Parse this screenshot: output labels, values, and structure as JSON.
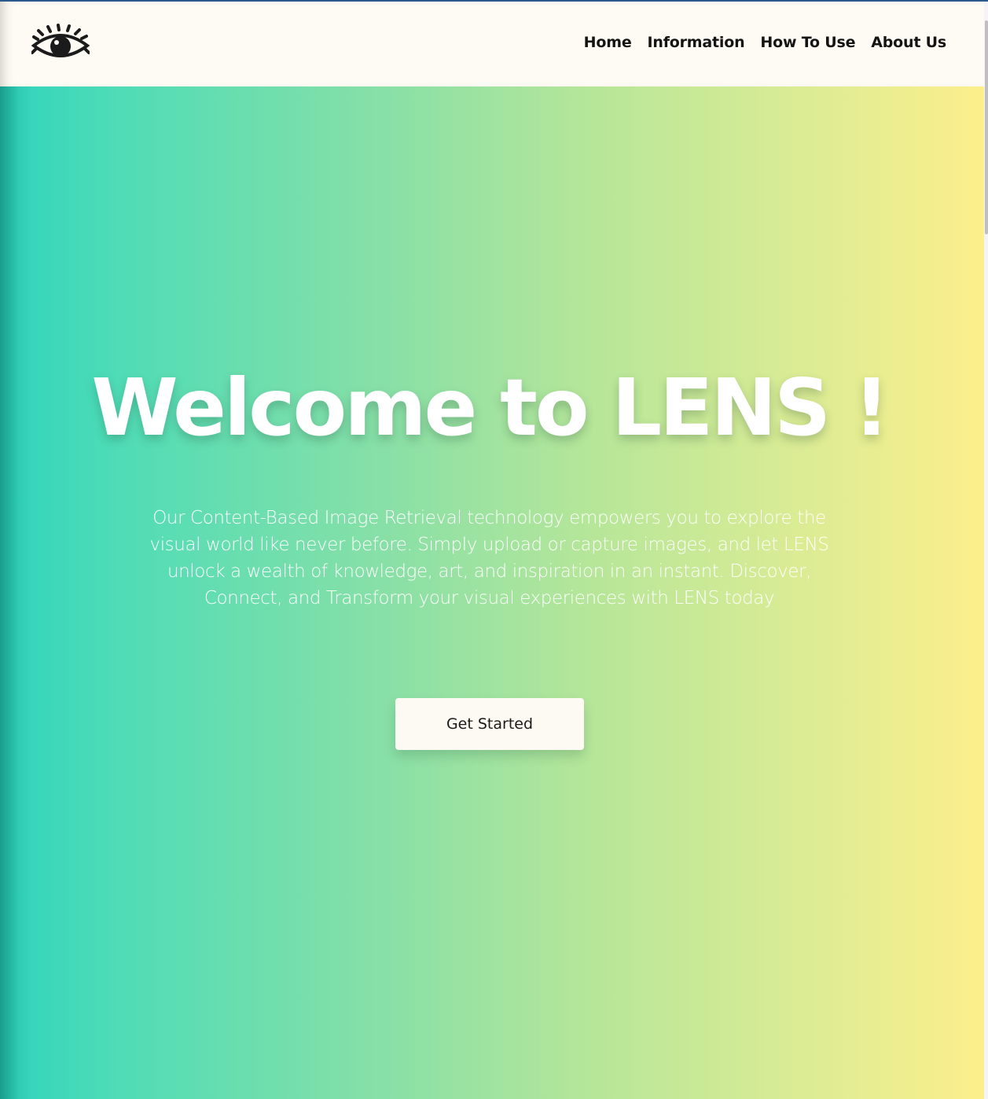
{
  "header": {
    "logo_icon": "eye-icon",
    "nav": [
      {
        "label": "Home"
      },
      {
        "label": "Information"
      },
      {
        "label": "How To Use"
      },
      {
        "label": "About Us"
      }
    ]
  },
  "hero": {
    "title": "Welcome to LENS !",
    "description": "Our Content-Based Image Retrieval technology empowers you to explore the visual world like never before. Simply upload or capture images, and let LENS unlock a wealth of knowledge, art, and inspiration in an instant. Discover, Connect, and Transform your visual experiences with LENS today",
    "cta_label": "Get Started"
  },
  "colors": {
    "gradient_start": "#2fd4bd",
    "gradient_end": "#fcef8c",
    "header_bg": "#fefbf4",
    "text_dark": "#141414"
  }
}
